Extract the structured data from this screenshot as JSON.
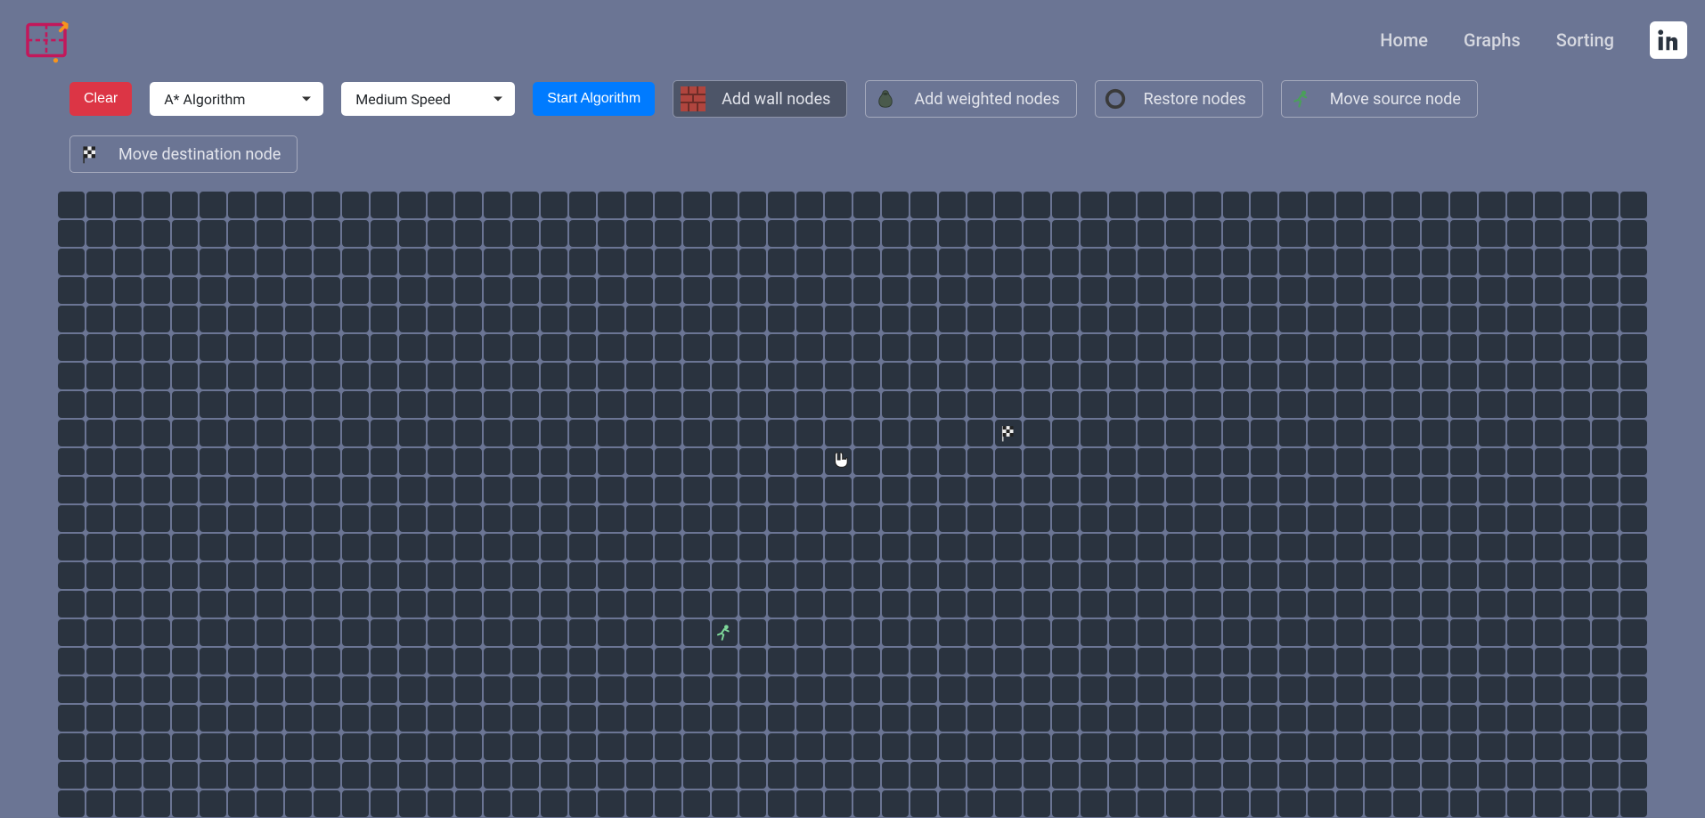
{
  "nav": {
    "home": "Home",
    "graphs": "Graphs",
    "sorting": "Sorting"
  },
  "toolbar": {
    "clear": "Clear",
    "algorithm_selected": "A* Algorithm",
    "speed_selected": "Medium Speed",
    "start": "Start Algorithm",
    "add_wall": "Add wall nodes",
    "add_weighted": "Add weighted nodes",
    "restore": "Restore nodes",
    "move_source": "Move source node",
    "move_destination": "Move destination node"
  },
  "grid": {
    "cols": 56,
    "rows": 22,
    "source": {
      "row": 15,
      "col": 23
    },
    "destination": {
      "row": 8,
      "col": 33
    },
    "cursor": {
      "row": 9,
      "col": 27
    }
  },
  "icons": {
    "wall": "brick-wall-icon",
    "weight": "weight-bag-icon",
    "restore": "ring-icon",
    "source": "runner-icon",
    "destination": "checkered-flag-icon",
    "linkedin": "linkedin-icon",
    "logo": "pathfinder-logo-icon"
  },
  "colors": {
    "bg": "#6b7594",
    "cell": "#2a333f",
    "danger": "#dc3545",
    "primary": "#007bff",
    "logo_accent": "#f7941d",
    "logo_main": "#c2185b"
  },
  "tool_active": "add_wall"
}
